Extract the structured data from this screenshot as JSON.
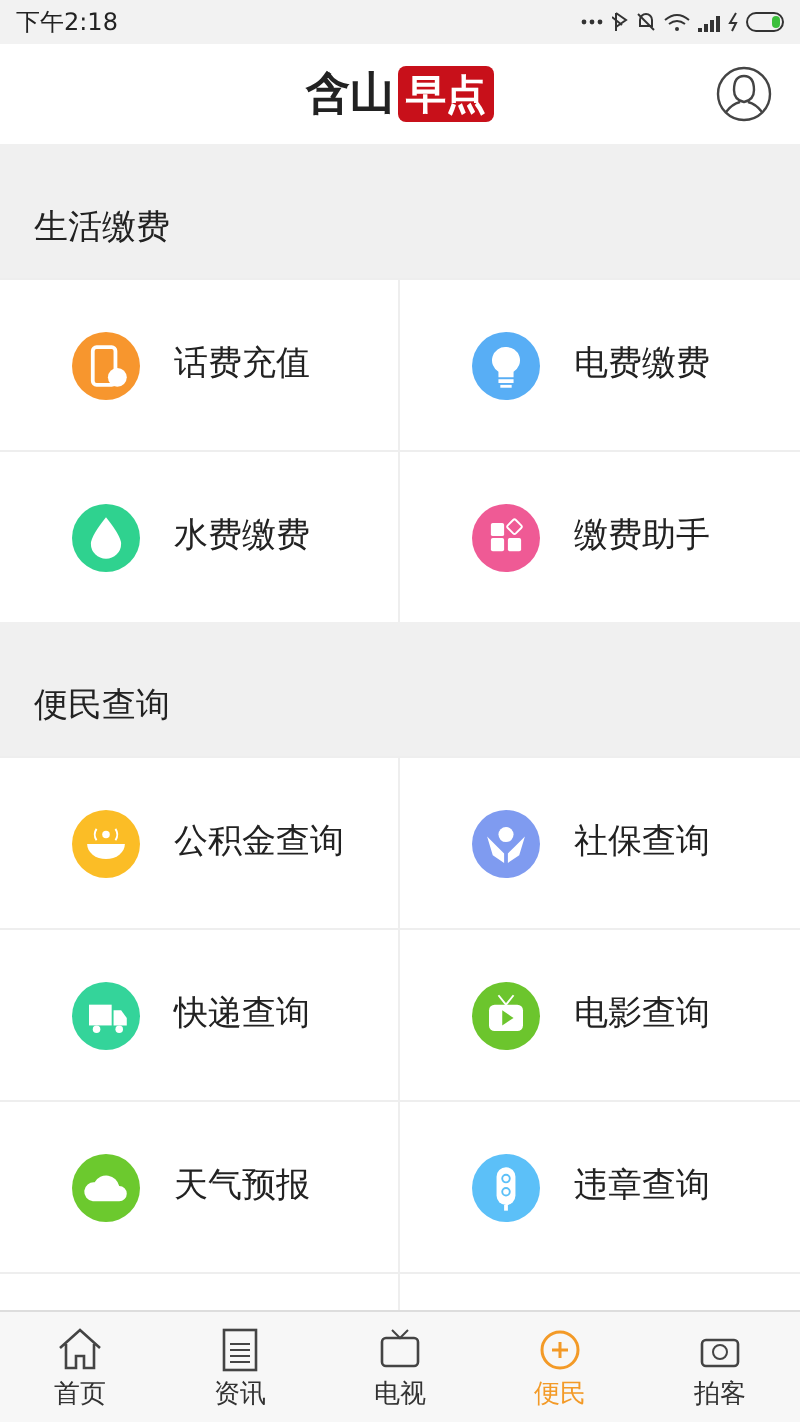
{
  "status_bar": {
    "time": "下午2:18"
  },
  "header": {
    "logo_left": "含山",
    "logo_right": "早点"
  },
  "sections": [
    {
      "title": "生活缴费",
      "items": [
        {
          "label": "话费充值",
          "kind": "phone",
          "color": "#f7962e"
        },
        {
          "label": "电费缴费",
          "kind": "bulb",
          "color": "#58aef5"
        },
        {
          "label": "水费缴费",
          "kind": "drop",
          "color": "#2fd28f"
        },
        {
          "label": "缴费助手",
          "kind": "grid",
          "color": "#ef5a95"
        }
      ]
    },
    {
      "title": "便民查询",
      "items": [
        {
          "label": "公积金查询",
          "kind": "bowl",
          "color": "#fbbd26"
        },
        {
          "label": "社保查询",
          "kind": "hands",
          "color": "#7f9bf0"
        },
        {
          "label": "快递查询",
          "kind": "truck",
          "color": "#34d49a"
        },
        {
          "label": "电影查询",
          "kind": "tv",
          "color": "#6cc52d"
        },
        {
          "label": "天气预报",
          "kind": "cloud",
          "color": "#6cc92e"
        },
        {
          "label": "违章查询",
          "kind": "light",
          "color": "#5cc0f8"
        }
      ]
    }
  ],
  "tabs": [
    {
      "label": "首页",
      "kind": "home",
      "selected": false
    },
    {
      "label": "资讯",
      "kind": "news",
      "selected": false
    },
    {
      "label": "电视",
      "kind": "tv",
      "selected": false
    },
    {
      "label": "便民",
      "kind": "service",
      "selected": true
    },
    {
      "label": "拍客",
      "kind": "camera",
      "selected": false
    }
  ]
}
